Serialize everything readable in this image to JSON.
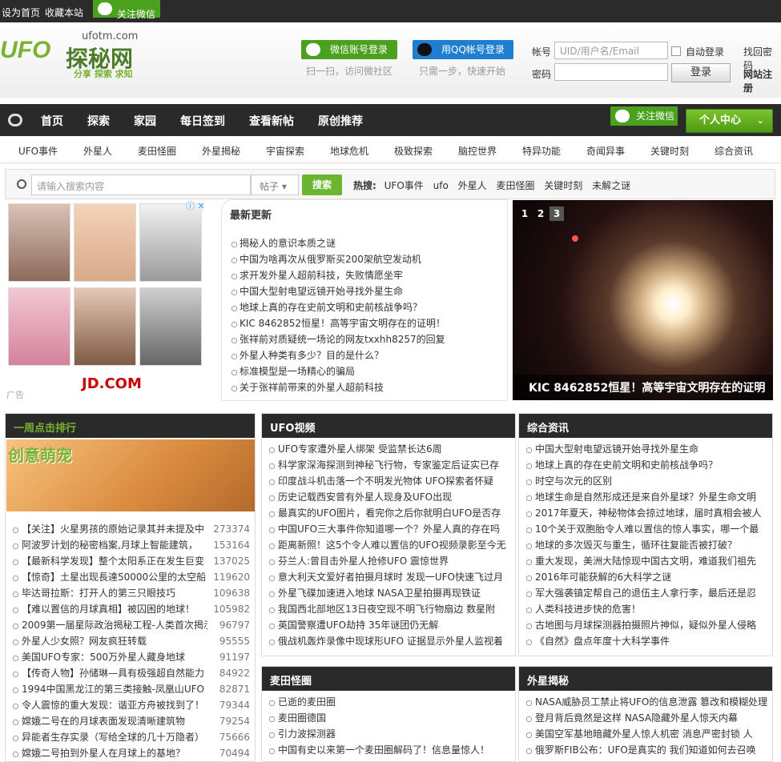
{
  "topbar": {
    "set_home": "设为首页",
    "bookmark": "收藏本站",
    "follow_wechat": "关注微信"
  },
  "logo": {
    "mark": "UFO",
    "name": "探秘网",
    "domain": "ufotm.com",
    "slogan": "分享 探索 求知"
  },
  "login": {
    "wechat_btn": "微信账号登录",
    "wechat_sub": "扫一扫，访问微社区",
    "qq_btn": "用QQ帐号登录",
    "qq_sub": "只需一步，快速开始",
    "account_label": "帐号",
    "account_placeholder": "UID/用户名/Email",
    "password_label": "密码",
    "auto_login": "自动登录",
    "login_btn": "登录",
    "find_password": "找回密码",
    "register": "网站注册"
  },
  "nav": {
    "items": [
      "首页",
      "探索",
      "家园",
      "每日签到",
      "查看新帖",
      "原创推荐"
    ],
    "follow_wechat": "关注微信",
    "user_center": "个人中心"
  },
  "categories": [
    "UFO事件",
    "外星人",
    "麦田怪圈",
    "外星揭秘",
    "宇宙探索",
    "地球危机",
    "极致探索",
    "脑控世界",
    "特异功能",
    "奇闻异事",
    "关键时刻",
    "综合资讯"
  ],
  "search": {
    "placeholder": "请输入搜索内容",
    "type": "帖子",
    "button": "搜索",
    "hot_label": "热搜:",
    "hot": [
      "UFO事件",
      "ufo",
      "外星人",
      "麦田怪圈",
      "关键时刻",
      "未解之谜"
    ]
  },
  "ad": {
    "brand": "JD.COM",
    "label": "广告"
  },
  "latest": {
    "title": "最新更新",
    "items": [
      "揭秘人的意识本质之谜",
      "中国为啥再次从俄罗斯买200架航空发动机",
      "求开发外星人超前科技，失败情愿坐牢",
      "中国大型射电望远镜开始寻找外星生命",
      "地球上真的存在史前文明和史前核战争吗？",
      "KIC 8462852恒星！高等宇宙文明存在的证明！",
      "张祥前对质疑统一场论的网友txxhh8257的回复",
      "外星人种类有多少？目的是什么？",
      "标准模型是一场精心的骗局",
      "关于张祥前带来的外星人超前科技"
    ]
  },
  "slider": {
    "pages": [
      "1",
      "2",
      "3"
    ],
    "caption": "KIC 8462852恒星！高等宇宙文明存在的证明"
  },
  "rank": {
    "title": "一周点击排行",
    "banner": "创意萌宠",
    "items": [
      {
        "t": "【关注】火星男孩的原始记录其并未提及中",
        "n": "273374"
      },
      {
        "t": "阿波罗计划的秘密档案,月球上智能建筑，",
        "n": "153164"
      },
      {
        "t": "【最新科学发现】整个太阳系正在发生巨变",
        "n": "137025"
      },
      {
        "t": "【惊奇】土星出现長達50000公里的太空船",
        "n": "119620"
      },
      {
        "t": "毕达哥拉斯：打开人的第三只眼技巧",
        "n": "109638"
      },
      {
        "t": "【难以置信的月球真相】被囚困的地球！",
        "n": "105982"
      },
      {
        "t": "2009第一届星际政治揭秘工程-人类首次揭示",
        "n": "96797"
      },
      {
        "t": "外星人少女照？网友疯狂转载",
        "n": "95555"
      },
      {
        "t": "美国UFO专家：500万外星人藏身地球",
        "n": "91197"
      },
      {
        "t": "【传奇人物】孙储琳—具有极强超自然能力",
        "n": "84922"
      },
      {
        "t": "1994中国黑龙江的第三类接触-凤凰山UFO",
        "n": "82871"
      },
      {
        "t": "令人震惊的重大发现：谐亚方舟被找到了！",
        "n": "79344"
      },
      {
        "t": "嫦娥二号在的月球表面发现清晰建筑物",
        "n": "79254"
      },
      {
        "t": "异能者生存实录（写给全球的几十万隐者）",
        "n": "75666"
      },
      {
        "t": "嫦娥二号拍到外星人在月球上的基地？",
        "n": "70494"
      }
    ]
  },
  "ufo_video": {
    "title": "UFO视频",
    "items": [
      "UFO专家遭外星人绑架 受监禁长达6周",
      "科学家深海探测到神秘飞行物，专家鉴定后证实已存",
      "印度战斗机击落一个不明发光物体 UFO探索者怀疑",
      "历史记载西安曾有外星人现身及UFO出现",
      "最真实的UFO图片，看完你之后你就明白UFO是否存",
      "中国UFO三大事件你知道哪一个？外星人真的存在吗",
      "距离新照！这5个令人难以置信的UFO视频录影至今无",
      "芬兰人:曾目击外星人抢修UFO 震惊世界",
      "意大利天文爱好者拍摄月球时 发现一UFO快速飞过月",
      "外星飞碟加速进入地球 NASA卫星拍摄再现铁证",
      "我国西北部地区13日夜空现不明飞行物扇边 数星附",
      "英国警察遭UFO劫持 35年谜团仍无解",
      "俄战机轰炸录像中现球形UFO 证据显示外星人监视着"
    ]
  },
  "news": {
    "title": "综合资讯",
    "items": [
      "中国大型射电望远镜开始寻找外星生命",
      "地球上真的存在史前文明和史前核战争吗？",
      "时空与次元的区别",
      "地球生命是自然形成还是来自外星球？外星生命文明",
      "2017年夏天，神秘物体会掠过地球，届时真相会被人",
      "10个关于双胞胎令人难以置信的惊人事实，哪一个最",
      "地球的多次毁灭与重生，循环往复能否被打破？",
      "重大发现，美洲大陆惊现中国古文明，难道我们祖先",
      "2016年可能获解的6大科学之谜",
      "军大强袭镇定帮自己的退伍主人拿行李，最后还是忍",
      "人类科技进步快的危害！",
      "古地图与月球探测器拍摄照片神似，疑似外星人侵略",
      "《自然》盘点年度十大科学事件"
    ]
  },
  "crop_circles": {
    "title": "麦田怪圈",
    "items": [
      "已逝的麦田圈",
      "麦田圈德国",
      "引力波探测器",
      "中国有史以来第一个麦田圈解码了！信息量惊人！"
    ]
  },
  "alien_reveal": {
    "title": "外星揭秘",
    "items": [
      "NASA威胁员工禁止将UFO的信息泄露 篡改和模糊处理",
      "登月背后竟然是这样 NASA隐藏外星人惊天内幕",
      "美国空军基地暗藏外星人惊人机密 消息严密封锁 人",
      "俄罗斯FIB公布：UFO是真实的 我们知道如何去召唤"
    ]
  },
  "colors": {
    "accent_green": "#4aa11d",
    "dark_bar": "#2a2a2a",
    "qq_blue": "#1f7ed0"
  }
}
